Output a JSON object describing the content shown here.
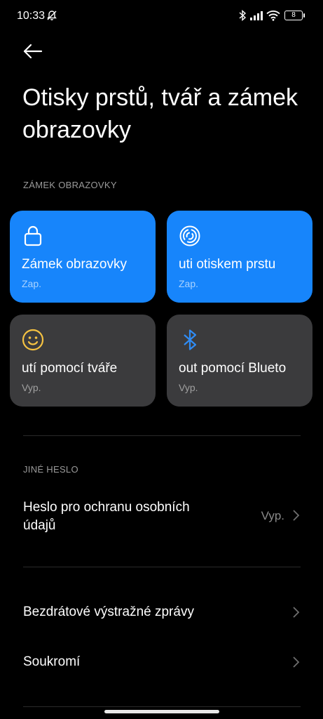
{
  "status_bar": {
    "time": "10:33",
    "battery": "8"
  },
  "page": {
    "title": "Otisky prstů, tvář a zámek obrazovky"
  },
  "screen_lock_section": {
    "header": "ZÁMEK OBRAZOVKY",
    "tiles": [
      {
        "label": "Zámek obrazovky",
        "state": "Zap.",
        "icon": "lock-icon",
        "active": true
      },
      {
        "label": "uti otiskem prstu",
        "state": "Zap.",
        "icon": "fingerprint-icon",
        "active": true
      },
      {
        "label": "utí pomocí tváře",
        "state": "Vyp.",
        "icon": "face-icon",
        "active": false
      },
      {
        "label": "out pomocí Blueto",
        "state": "Vyp.",
        "icon": "bluetooth-icon",
        "active": false
      }
    ]
  },
  "other_password_section": {
    "header": "JINÉ HESLO",
    "privacy_password": {
      "label_line1": "Heslo pro ochranu osobních",
      "label_line2": "údajů",
      "value": "Vyp."
    }
  },
  "menu": {
    "wireless_alerts": "Bezdrátové výstražné zprávy",
    "privacy": "Soukromí"
  },
  "colors": {
    "accent": "#1785fb",
    "tile_off": "#3b3b3d",
    "face_icon": "#f5c242",
    "bluetooth_icon": "#2f8cf5"
  }
}
